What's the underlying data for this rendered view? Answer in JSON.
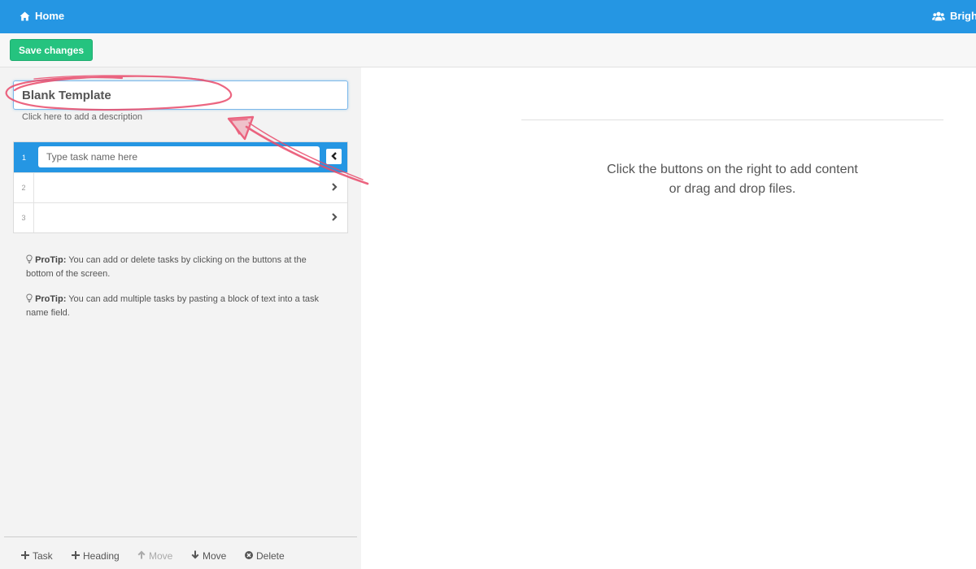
{
  "topbar": {
    "home_label": "Home",
    "org_label": "Bright S"
  },
  "toolbar": {
    "save_label": "Save changes"
  },
  "checklist": {
    "title_value": "Blank Template",
    "description_prompt": "Click here to add a description",
    "tasks": [
      {
        "number": "1",
        "placeholder": "Type task name here",
        "value": ""
      },
      {
        "number": "2",
        "value": ""
      },
      {
        "number": "3",
        "value": ""
      }
    ]
  },
  "protips": [
    {
      "label": "ProTip:",
      "text": " You can add or delete tasks by clicking on the buttons at the bottom of the screen."
    },
    {
      "label": "ProTip:",
      "text": " You can add multiple tasks by pasting a block of text into a task name field."
    }
  ],
  "bottom_bar": {
    "task_label": "Task",
    "heading_label": "Heading",
    "move_up_label": "Move",
    "move_down_label": "Move",
    "delete_label": "Delete"
  },
  "content": {
    "empty_line1": "Click the buttons on the right to add content",
    "empty_line2": "or drag and drop files."
  },
  "colors": {
    "topbar": "#2596e3",
    "save_button": "#25c37f",
    "annotation": "#e94b6b"
  },
  "icons": [
    "home-icon",
    "users-icon",
    "chevron-left-icon",
    "chevron-right-icon",
    "lightbulb-icon",
    "plus-icon",
    "arrow-up-icon",
    "arrow-down-icon",
    "times-circle-icon"
  ]
}
